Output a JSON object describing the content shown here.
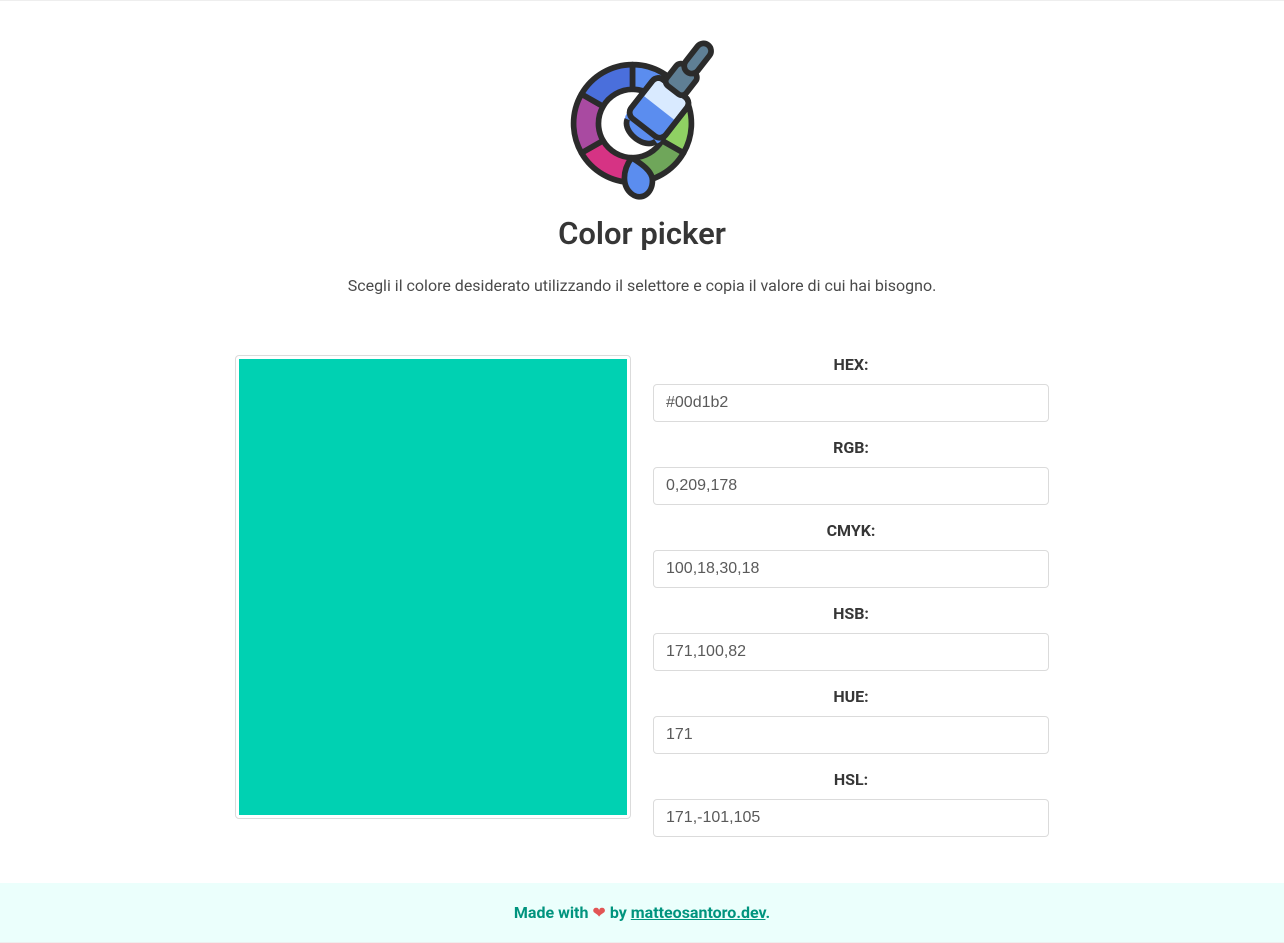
{
  "header": {
    "title": "Color picker",
    "subtitle": "Scegli il colore desiderato utilizzando il selettore e copia il valore di cui hai bisogno."
  },
  "color": {
    "selected": "#00d1b2"
  },
  "fields": {
    "hex": {
      "label": "HEX:",
      "value": "#00d1b2"
    },
    "rgb": {
      "label": "RGB:",
      "value": "0,209,178"
    },
    "cmyk": {
      "label": "CMYK:",
      "value": "100,18,30,18"
    },
    "hsb": {
      "label": "HSB:",
      "value": "171,100,82"
    },
    "hue": {
      "label": "HUE:",
      "value": "171"
    },
    "hsl": {
      "label": "HSL:",
      "value": "171,-101,105"
    }
  },
  "footer": {
    "made_with": "Made with",
    "heart": "❤",
    "by": "by",
    "author": "matteosantoro.dev",
    "period": "."
  }
}
